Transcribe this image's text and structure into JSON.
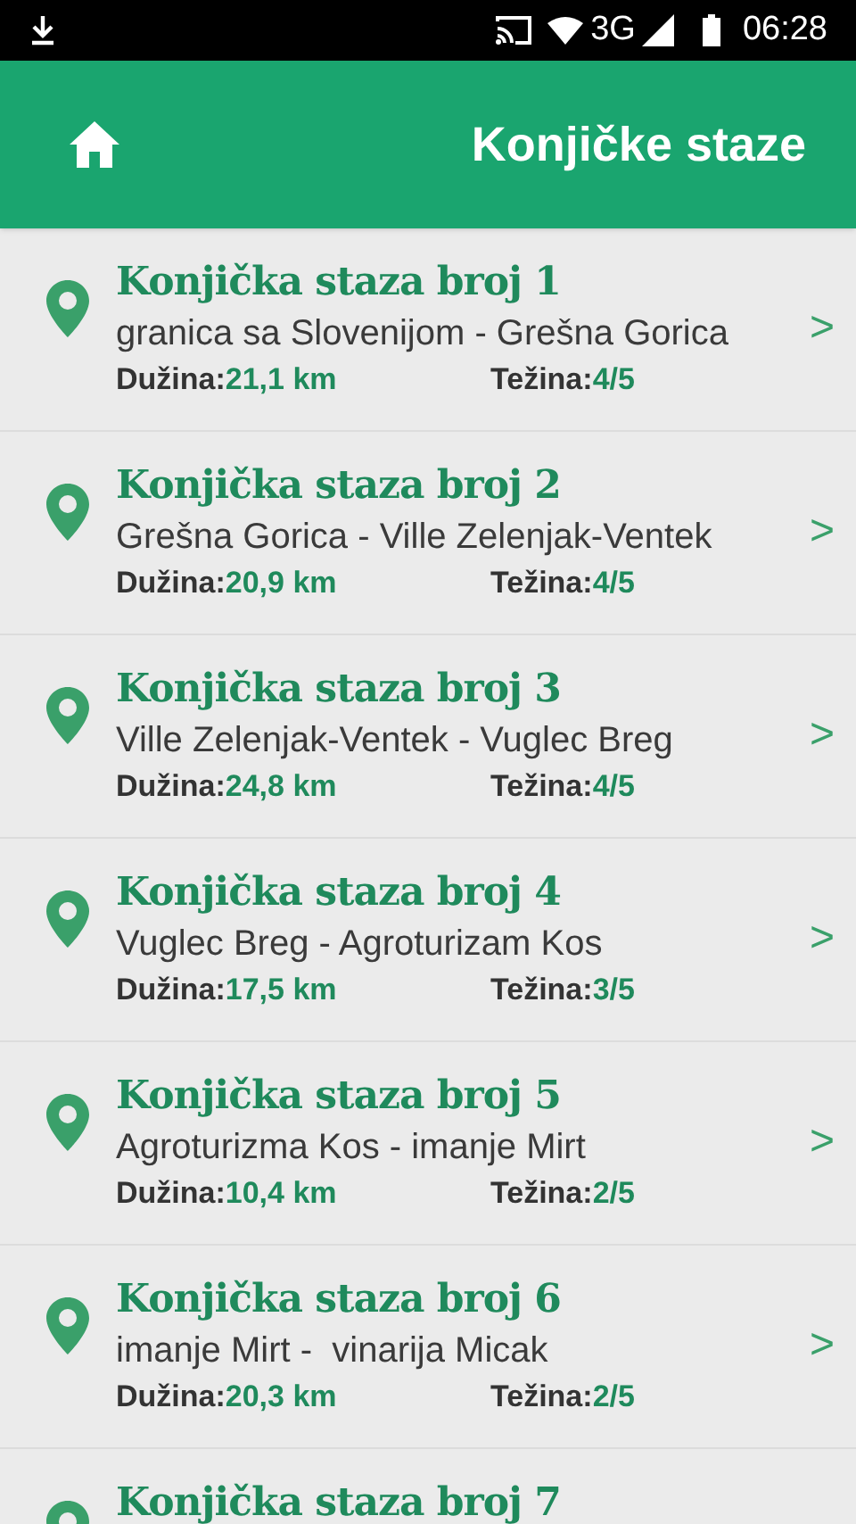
{
  "status_bar": {
    "network": "3G",
    "time": "06:28"
  },
  "header": {
    "title": "Konjičke staze"
  },
  "trails": [
    {
      "title": "Konjička staza broj 1",
      "route": "granica sa Slovenijom - Grešna Gorica",
      "length_label": "Dužina:",
      "length": "21,1 km",
      "difficulty_label": "Težina:",
      "difficulty": "4/5",
      "chevron": ">"
    },
    {
      "title": "Konjička staza broj 2",
      "route": "Grešna Gorica - Ville Zelenjak-Ventek",
      "length_label": "Dužina:",
      "length": "20,9 km",
      "difficulty_label": "Težina:",
      "difficulty": "4/5",
      "chevron": ">"
    },
    {
      "title": "Konjička staza broj 3",
      "route": "Ville Zelenjak-Ventek - Vuglec Breg",
      "length_label": "Dužina:",
      "length": "24,8 km",
      "difficulty_label": "Težina:",
      "difficulty": "4/5",
      "chevron": ">"
    },
    {
      "title": "Konjička staza broj 4",
      "route": "Vuglec Breg - Agroturizam Kos",
      "length_label": "Dužina:",
      "length": "17,5 km",
      "difficulty_label": "Težina:",
      "difficulty": "3/5",
      "chevron": ">"
    },
    {
      "title": "Konjička staza broj 5",
      "route": "Agroturizma Kos - imanje Mirt",
      "length_label": "Dužina:",
      "length": "10,4 km",
      "difficulty_label": "Težina:",
      "difficulty": "2/5",
      "chevron": ">"
    },
    {
      "title": "Konjička staza broj 6",
      "route": "imanje Mirt -  vinarija Micak",
      "length_label": "Dužina:",
      "length": "20,3 km",
      "difficulty_label": "Težina:",
      "difficulty": "2/5",
      "chevron": ">"
    },
    {
      "title": "Konjička staza broj 7"
    }
  ]
}
